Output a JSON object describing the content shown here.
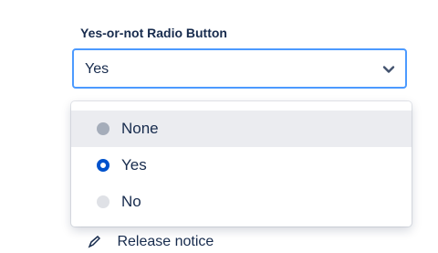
{
  "field": {
    "label": "Yes-or-not Radio Button",
    "selected_value": "Yes"
  },
  "menu": {
    "options": [
      {
        "label": "None",
        "state": "hover"
      },
      {
        "label": "Yes",
        "state": "selected"
      },
      {
        "label": "No",
        "state": "unselected"
      }
    ]
  },
  "partial_below": {
    "label": "Release notice"
  },
  "colors": {
    "focus_border": "#4c9aff",
    "radio_selected": "#0052cc",
    "hover_bg": "#ebecf0",
    "text": "#172b4d"
  },
  "icons": {
    "dropdown": "chevron-down-icon",
    "below_item": "pencil-icon"
  }
}
